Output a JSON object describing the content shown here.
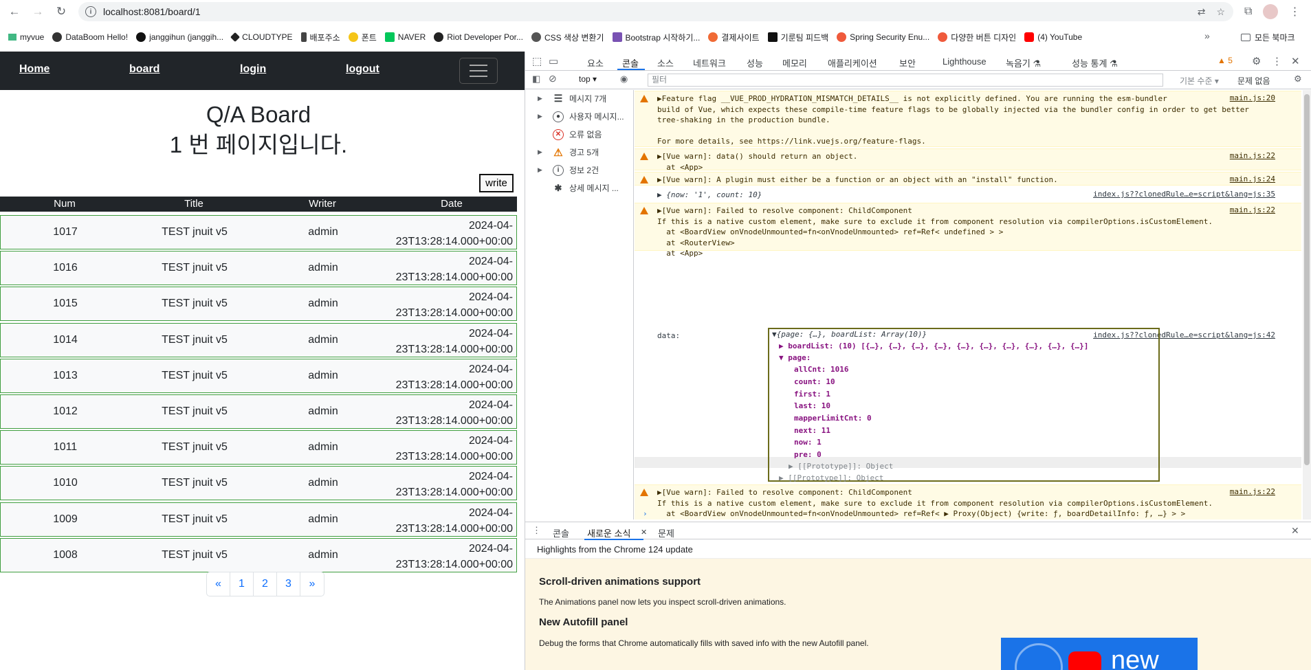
{
  "browser": {
    "url": "localhost:8081/board/1",
    "bookmarks": [
      "myvue",
      "DataBoom Hello!",
      "janggihun (janggih...",
      "CLOUDTYPE",
      "배포주소",
      "폰트",
      "NAVER",
      "Riot Developer Por...",
      "CSS 색상 변환기",
      "Bootstrap 시작하기...",
      "결제사이트",
      "기룬팀 피드백",
      "Spring Security Enu...",
      "다양한 버튼 디자인",
      "(4) YouTube"
    ],
    "all_bookmarks": "모든 북마크",
    "more": "»"
  },
  "page": {
    "nav": {
      "home": "Home",
      "board": "board",
      "login": "login",
      "logout": "logout"
    },
    "title": "Q/A Board",
    "subtitle": "1 번 페이지입니다.",
    "write_label": "write",
    "columns": [
      "Num",
      "Title",
      "Writer",
      "Date"
    ],
    "rows": [
      {
        "num": "1017",
        "title": "TEST jnuit v5",
        "writer": "admin",
        "date": "2024-04-23T13:28:14.000+00:00"
      },
      {
        "num": "1016",
        "title": "TEST jnuit v5",
        "writer": "admin",
        "date": "2024-04-23T13:28:14.000+00:00"
      },
      {
        "num": "1015",
        "title": "TEST jnuit v5",
        "writer": "admin",
        "date": "2024-04-23T13:28:14.000+00:00"
      },
      {
        "num": "1014",
        "title": "TEST jnuit v5",
        "writer": "admin",
        "date": "2024-04-23T13:28:14.000+00:00"
      },
      {
        "num": "1013",
        "title": "TEST jnuit v5",
        "writer": "admin",
        "date": "2024-04-23T13:28:14.000+00:00"
      },
      {
        "num": "1012",
        "title": "TEST jnuit v5",
        "writer": "admin",
        "date": "2024-04-23T13:28:14.000+00:00"
      },
      {
        "num": "1011",
        "title": "TEST jnuit v5",
        "writer": "admin",
        "date": "2024-04-23T13:28:14.000+00:00"
      },
      {
        "num": "1010",
        "title": "TEST jnuit v5",
        "writer": "admin",
        "date": "2024-04-23T13:28:14.000+00:00"
      },
      {
        "num": "1009",
        "title": "TEST jnuit v5",
        "writer": "admin",
        "date": "2024-04-23T13:28:14.000+00:00"
      },
      {
        "num": "1008",
        "title": "TEST jnuit v5",
        "writer": "admin",
        "date": "2024-04-23T13:28:14.000+00:00"
      }
    ],
    "pager": [
      "«",
      "1",
      "2",
      "3",
      "»"
    ]
  },
  "devtools": {
    "tabs": [
      "요소",
      "콘솔",
      "소스",
      "네트워크",
      "성능",
      "메모리",
      "애플리케이션",
      "보안",
      "Lighthouse",
      "녹음기 ⚗",
      "성능 통계 ⚗"
    ],
    "warning_count": "5",
    "context": "top",
    "filter_placeholder": "필터",
    "level": "기본 수준",
    "issues": "문제 없음",
    "sidebar": [
      {
        "label": "메시지 7개",
        "icon": "list-icon"
      },
      {
        "label": "사용자 메시지...",
        "icon": "user-icon"
      },
      {
        "label": "오류 없음",
        "icon": "error-icon"
      },
      {
        "label": "경고 5개",
        "icon": "warning-icon"
      },
      {
        "label": "정보 2건",
        "icon": "info-icon"
      },
      {
        "label": "상세 메시지 ...",
        "icon": "bug-icon"
      }
    ],
    "messages": {
      "m1": "▶Feature flag __VUE_PROD_HYDRATION_MISMATCH_DETAILS__ is not explicitly defined. You are running the esm-bundler\nbuild of Vue, which expects these compile-time feature flags to be globally injected via the bundler config in order to get better\ntree-shaking in the production bundle.\n\nFor more details, see https://link.vuejs.org/feature-flags.",
      "m1_src": "main.js:20",
      "m2": "▶[Vue warn]: data() should return an object.\n  at <App>",
      "m2_src": "main.js:22",
      "m3": "▶[Vue warn]: A plugin must either be a function or an object with an \"install\" function.",
      "m3_src": "main.js:24",
      "m4": "▶ {now: '1', count: 10}",
      "m4_src": "index.js??clonedRule…e=script&lang=js:35",
      "m5": "▶[Vue warn]: Failed to resolve component: ChildComponent\nIf this is a native custom element, make sure to exclude it from component resolution via compilerOptions.isCustomElement.\n  at <BoardView onVnodeUnmounted=fn<onVnodeUnmounted> ref=Ref< undefined > >\n  at <RouterView>\n  at <App>",
      "m5_src": "main.js:22",
      "m6": "data:",
      "m6_src": "index.js??clonedRule…e=script&lang=js:42",
      "m7": "▶[Vue warn]: Failed to resolve component: ChildComponent\nIf this is a native custom element, make sure to exclude it from component resolution via compilerOptions.isCustomElement.\n  at <BoardView onVnodeUnmounted=fn<onVnodeUnmounted> ref=Ref< ▶ Proxy(Object) {write: ƒ, boardDetailInfo: ƒ, …} > >\n  at <RouterView>\n  at <App>",
      "m7_src": "main.js:22"
    },
    "object": {
      "summary": "▼{page: {…}, boardList: Array(10)}",
      "boardList": "▶ boardList: (10) [{…}, {…}, {…}, {…}, {…}, {…}, {…}, {…}, {…}, {…}]",
      "page": "▼ page:",
      "allCnt": "allCnt: 1016",
      "count": "count: 10",
      "first": "first: 1",
      "last": "last: 10",
      "mapperLimitCnt": "mapperLimitCnt: 0",
      "next": "next: 11",
      "now": "now: 1",
      "pre": "pre: 0",
      "proto1": "▶ [[Prototype]]: Object",
      "proto2": "▶ [[Prototype]]: Object"
    },
    "prompt": "›",
    "drawer_tabs": [
      "콘솔",
      "새로운 소식",
      "문제"
    ],
    "drawer_close": "✕",
    "news": {
      "highlight": "Highlights from the Chrome 124 update",
      "h1": "Scroll-driven animations support",
      "p1": "The Animations panel now lets you inspect scroll-driven animations.",
      "h2": "New Autofill panel",
      "p2": "Debug the forms that Chrome automatically fills with saved info with the new Autofill panel.",
      "img_text": "new"
    }
  }
}
